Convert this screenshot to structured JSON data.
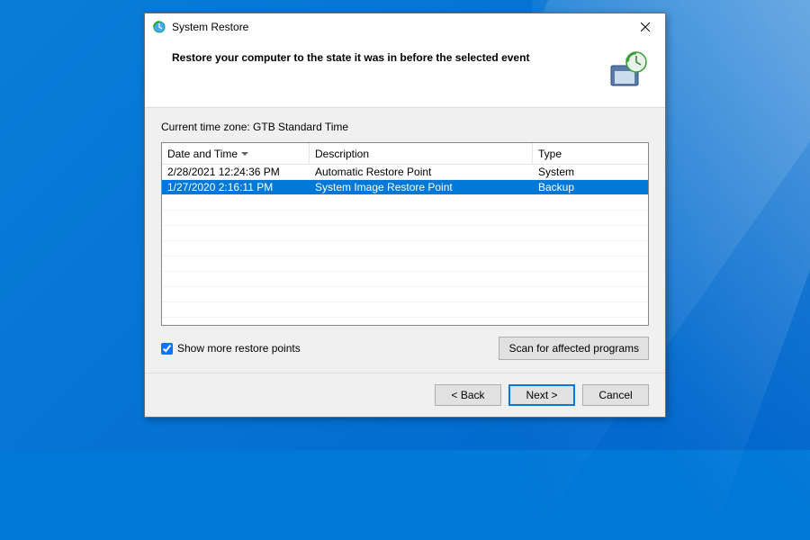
{
  "window": {
    "title": "System Restore"
  },
  "header": {
    "heading": "Restore your computer to the state it was in before the selected event"
  },
  "body": {
    "timezone_label": "Current time zone: GTB Standard Time",
    "columns": {
      "date": "Date and Time",
      "desc": "Description",
      "type": "Type"
    },
    "rows": [
      {
        "date": "2/28/2021 12:24:36 PM",
        "desc": "Automatic Restore Point",
        "type": "System",
        "selected": false
      },
      {
        "date": "1/27/2020 2:16:11 PM",
        "desc": "System Image Restore Point",
        "type": "Backup",
        "selected": true
      }
    ],
    "show_more_label": "Show more restore points",
    "show_more_checked": true,
    "scan_button": "Scan for affected programs"
  },
  "footer": {
    "back": "< Back",
    "next": "Next >",
    "cancel": "Cancel"
  }
}
